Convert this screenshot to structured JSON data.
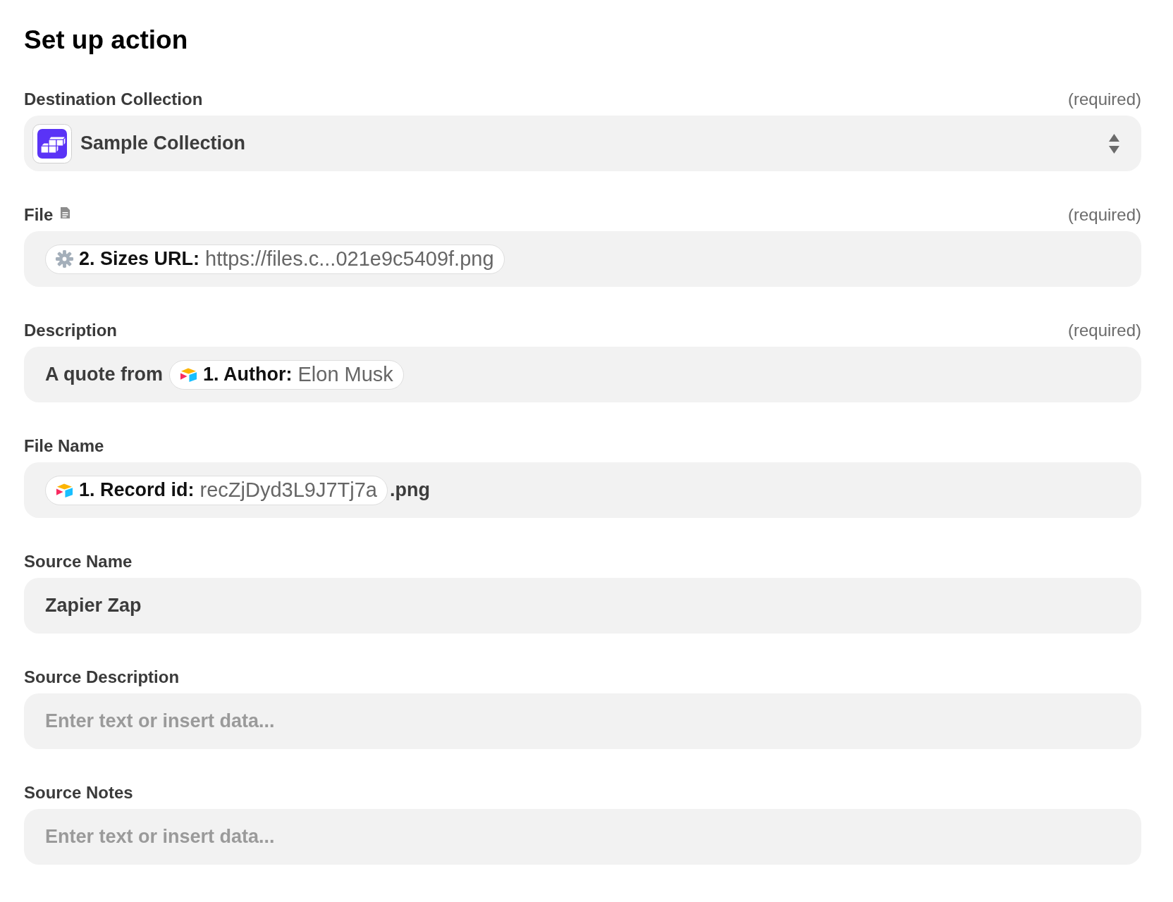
{
  "title": "Set up action",
  "fields": [
    {
      "kind": "select",
      "label": "Destination Collection",
      "label_icon": false,
      "required_note": "(required)",
      "value": "Sample Collection"
    },
    {
      "kind": "text",
      "label": "File",
      "label_icon": true,
      "required_note": "(required)",
      "content": [
        {
          "kind": "gear",
          "step": "2. Sizes URL:",
          "value": "https://files.c...021e9c5409f.png"
        }
      ]
    },
    {
      "kind": "text",
      "label": "Description",
      "label_icon": false,
      "required_note": "(required)",
      "content": [
        {
          "kind": "text",
          "text": "A quote from"
        },
        {
          "kind": "box",
          "step": "1. Author:",
          "value": "Elon Musk"
        }
      ]
    },
    {
      "kind": "text",
      "label": "File Name",
      "label_icon": false,
      "content": [
        {
          "kind": "box",
          "step": "1. Record id:",
          "value": "recZjDyd3L9J7Tj7a"
        },
        {
          "kind": "text",
          "text": ".png"
        }
      ]
    },
    {
      "kind": "text",
      "label": "Source Name",
      "label_icon": false,
      "content": [
        {
          "kind": "text",
          "text": "Zapier Zap"
        }
      ]
    },
    {
      "kind": "text",
      "label": "Source Description",
      "label_icon": false,
      "placeholder": "Enter text or insert data..."
    },
    {
      "kind": "text",
      "label": "Source Notes",
      "label_icon": false,
      "placeholder": "Enter text or insert data..."
    }
  ]
}
